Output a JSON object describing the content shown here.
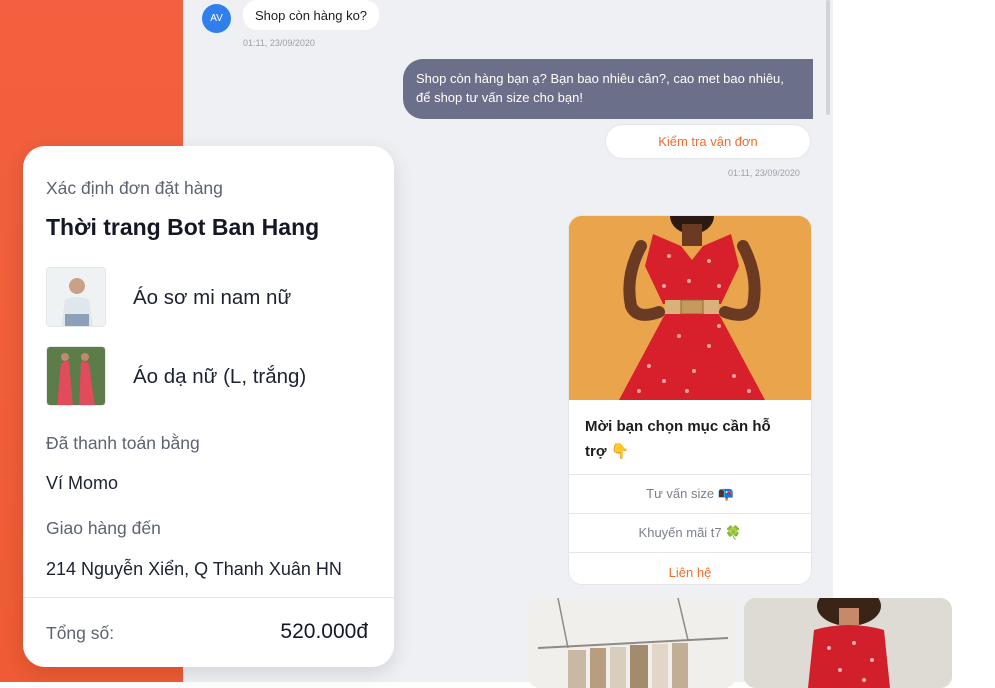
{
  "chat": {
    "avatar_initials": "AV",
    "incoming_message": "Shop còn hàng ko?",
    "incoming_time": "01:11, 23/09/2020",
    "outgoing_message": "Shop còn hàng bạn ạ? Bạn bao nhiêu cân?, cao met bao nhiêu, để shop tư vấn size cho bạn!",
    "quick_reply": "Kiểm tra vận đơn",
    "outgoing_time": "01:11, 23/09/2020"
  },
  "product_card": {
    "prompt": "Mời bạn chọn mục cần hỗ trợ 👇",
    "buttons": [
      "Tư vấn size 📭",
      "Khuyến mãi t7 🍀",
      "Liên hệ"
    ]
  },
  "order": {
    "header": "Xác định đơn đặt hàng",
    "shop_name": "Thời trang Bot Ban Hang",
    "items": [
      "Áo sơ mi nam nữ",
      "Áo dạ nữ (L, trắng)"
    ],
    "payment_label": "Đã thanh toán bằng",
    "payment_value": "Ví Momo",
    "shipping_label": "Giao hàng đến",
    "shipping_value": "214 Nguyễn Xiển, Q Thanh Xuân HN",
    "total_label": "Tổng số:",
    "total_value": "520.000đ"
  }
}
